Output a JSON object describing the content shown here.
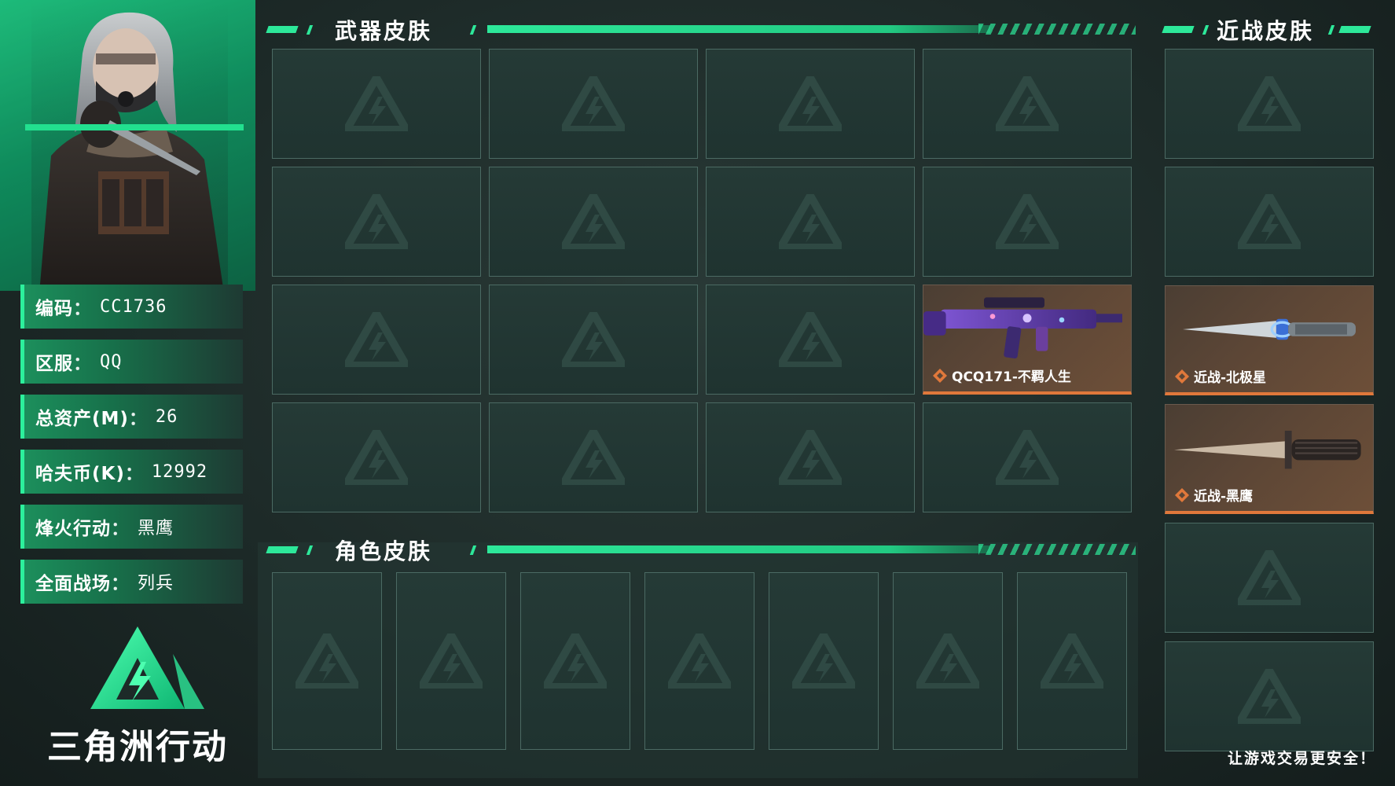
{
  "profile": {
    "rows": [
      {
        "key": "编码",
        "value": "CC1736"
      },
      {
        "key": "区服",
        "value": "QQ"
      },
      {
        "key": "总资产(M)",
        "value": "26"
      },
      {
        "key": "哈夫币(K)",
        "value": "12992"
      },
      {
        "key": "烽火行动",
        "value": "黑鹰"
      },
      {
        "key": "全面战场",
        "value": "列兵"
      }
    ],
    "colon": "："
  },
  "logo": {
    "text": "三角洲行动"
  },
  "weapon_section": {
    "title": "武器皮肤",
    "items": [
      "",
      "",
      "",
      "",
      "",
      "",
      "",
      "",
      "",
      "",
      "",
      "QCQ171-不羁人生",
      "",
      "",
      "",
      ""
    ]
  },
  "melee_section": {
    "title": "近战皮肤",
    "items": [
      "",
      "",
      "近战-北极星",
      "近战-黑鹰",
      "",
      ""
    ]
  },
  "role_section": {
    "title": "角色皮肤",
    "items": [
      "",
      "",
      "",
      "",
      "",
      "",
      ""
    ]
  },
  "footer": {
    "slogan": "让游戏交易更安全！"
  },
  "colors": {
    "accent": "#2de89a",
    "rarity_orange": "#e0783b",
    "bg": "#1d2a28"
  },
  "icons": {
    "placeholder": "delta-triangle-icon",
    "rarity": "diamond-rarity-icon"
  }
}
